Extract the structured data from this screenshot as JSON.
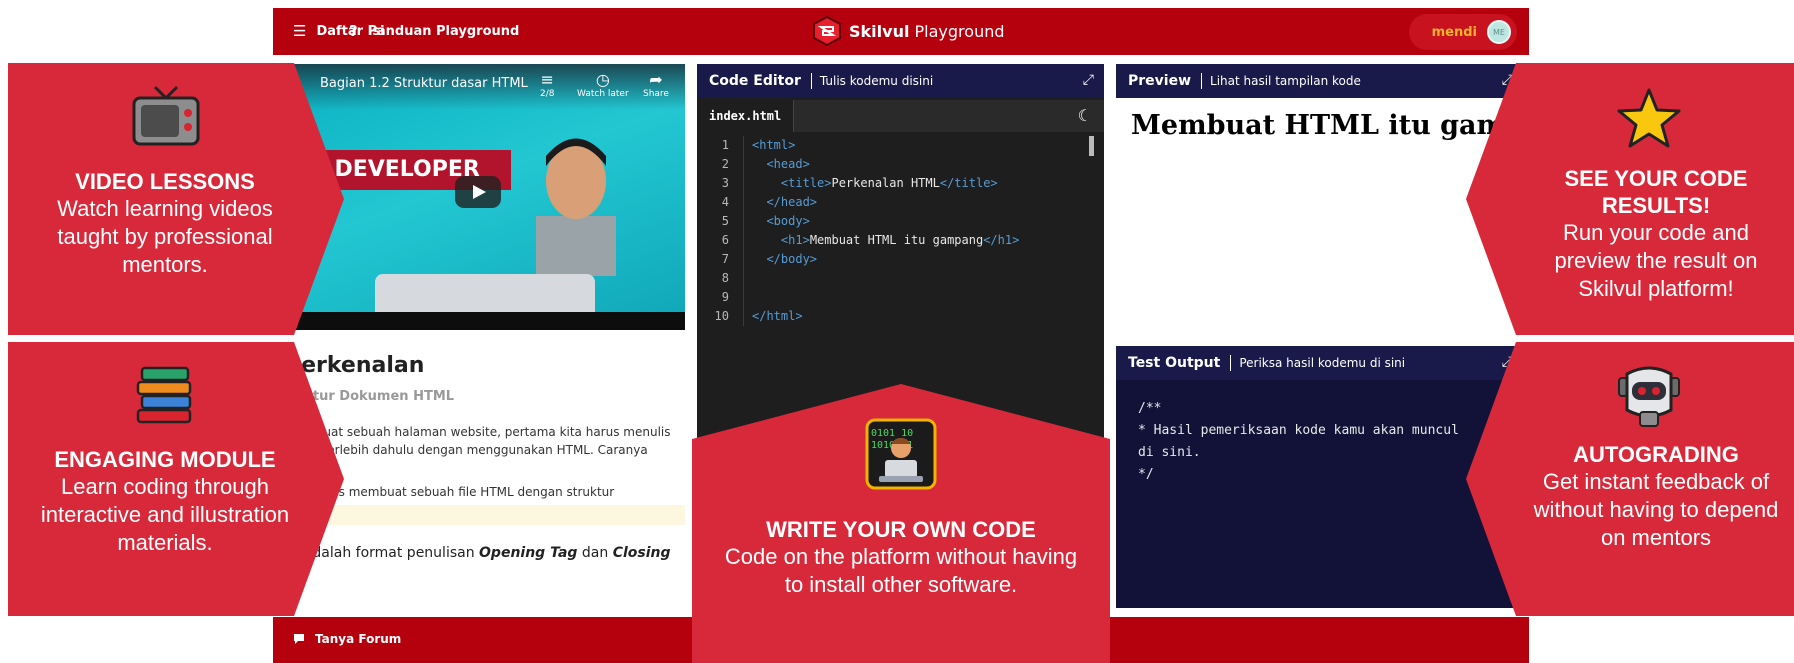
{
  "header": {
    "menu_label": "Daftar Isi",
    "guide_label": "Panduan Playground",
    "brand_bold": "Skilvul",
    "brand_rest": "Playground",
    "user_name": "mendi",
    "avatar_initials": "ME"
  },
  "footer": {
    "forum_label": "Tanya Forum"
  },
  "video": {
    "title": "Bagian 1.2 Struktur dasar HTML",
    "counter": "2/8",
    "watch_later": "Watch later",
    "share": "Share",
    "banner_text": "EB DEVELOPER"
  },
  "module": {
    "title": "Perkenalan",
    "subtitle": "uktur Dokumen HTML",
    "para1": "membuat sebuah halaman website, pertama kita harus menulis",
    "para2": "a-nya terlebih dahulu dengan menggunakan HTML. Caranya",
    "para3": "?",
    "para4": "kita harus membuat sebuah file HTML dengan struktur",
    "foot_text": "ut adalah format penulisan ",
    "foot_tag1": "Opening Tag",
    "foot_and": " dan ",
    "foot_tag2": "Closing",
    "foot_end": ":"
  },
  "editor": {
    "title": "Code Editor",
    "subtitle": "Tulis kodemu disini",
    "file_name": "index.html",
    "lines": [
      {
        "n": "1",
        "code": "<html>"
      },
      {
        "n": "2",
        "code": "  <head>"
      },
      {
        "n": "3",
        "code": "    <title>Perkenalan HTML</title>"
      },
      {
        "n": "4",
        "code": "  </head>"
      },
      {
        "n": "5",
        "code": "  <body>"
      },
      {
        "n": "6",
        "code": "    <h1>Membuat HTML itu gampang</h1>"
      },
      {
        "n": "7",
        "code": "  </body>"
      },
      {
        "n": "8",
        "code": ""
      },
      {
        "n": "9",
        "code": ""
      },
      {
        "n": "10",
        "code": "</html>"
      }
    ]
  },
  "preview": {
    "title": "Preview",
    "subtitle": "Lihat hasil tampilan kode",
    "h1": "Membuat HTML itu gampang"
  },
  "output": {
    "title": "Test Output",
    "subtitle": "Periksa hasil kodemu di sini",
    "text": "/**\n* Hasil pemeriksaan kode kamu akan muncul\ndi sini.\n*/"
  },
  "promos": {
    "video": {
      "title": "VIDEO LESSONS",
      "body": "Watch learning videos taught by professional mentors."
    },
    "module": {
      "title": "ENGAGING MODULE",
      "body": "Learn coding through interactive and illustration materials."
    },
    "code": {
      "title": "WRITE YOUR OWN CODE",
      "body": "Code on the platform without having to install other software."
    },
    "results": {
      "title": "SEE YOUR CODE RESULTS!",
      "body": "Run your code and preview the result on Skilvul platform!"
    },
    "autograde": {
      "title": "AUTOGRADING",
      "body": "Get instant feedback of without having to depend on mentors"
    }
  },
  "icons": {
    "menu": "hamburger-icon",
    "guide": "question-icon",
    "brand": "skilvul-logo-icon",
    "forum": "chat-bubble-icon",
    "expand": "expand-icon",
    "theme": "moon-icon",
    "promo_video": "retro-tv-icon",
    "promo_module": "books-icon",
    "promo_code": "coder-icon",
    "promo_results": "star-icon",
    "promo_autograde": "robot-icon"
  },
  "colors": {
    "bar_red": "#b5000d",
    "promo_red": "#d8293b",
    "pane_navy": "#1a1a4a",
    "output_bg": "#121238",
    "user_name": "#ffb22e"
  }
}
